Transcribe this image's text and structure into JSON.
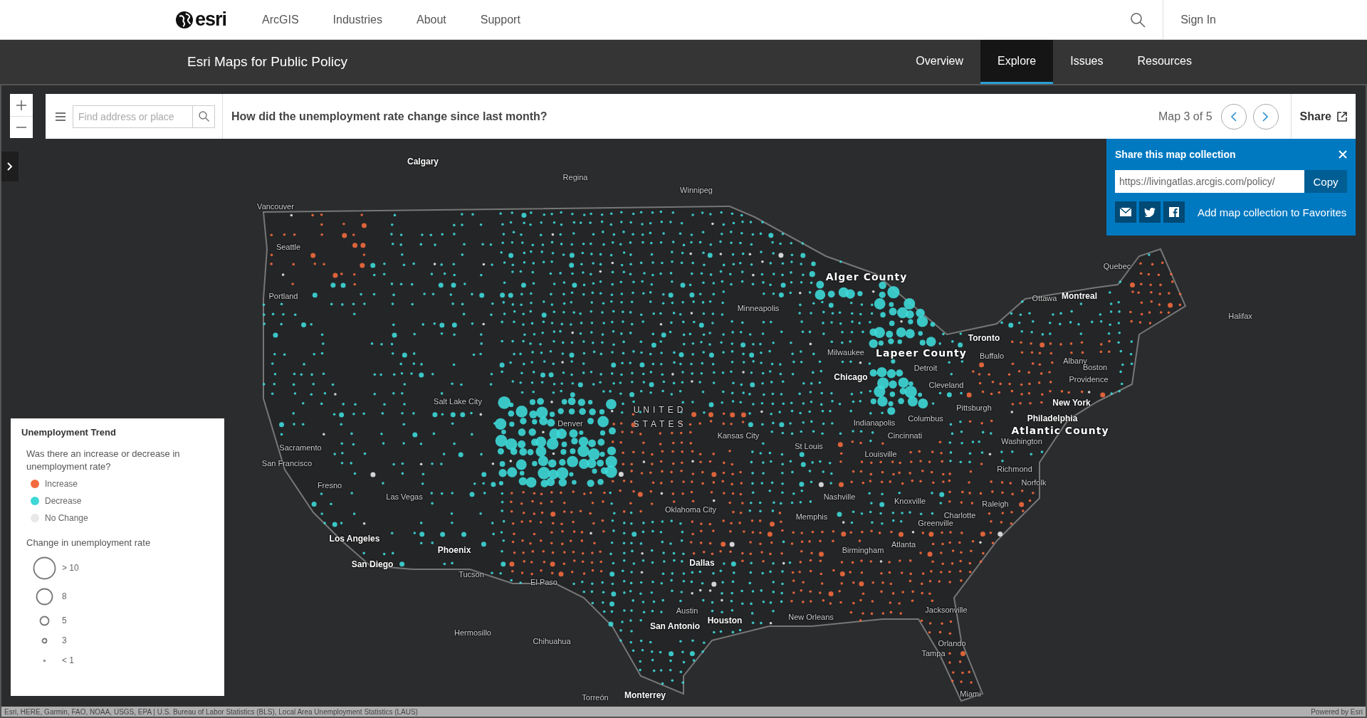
{
  "top_nav": {
    "logo": "esri",
    "links": [
      "ArcGIS",
      "Industries",
      "About",
      "Support"
    ],
    "sign_in": "Sign In"
  },
  "sub_nav": {
    "title": "Esri Maps for Public Policy",
    "tabs": [
      {
        "label": "Overview",
        "selected": false
      },
      {
        "label": "Explore",
        "selected": true
      },
      {
        "label": "Issues",
        "selected": false
      },
      {
        "label": "Resources",
        "selected": false
      }
    ]
  },
  "toolbar": {
    "search": {
      "placeholder": "Find address or place"
    },
    "question": "How did the unemployment rate change since last month?",
    "map_counter": "Map 3 of 5",
    "share": "Share"
  },
  "share_panel": {
    "title": "Share this map collection",
    "url": "https://livingatlas.arcgis.com/policy/",
    "copy": "Copy",
    "favorites": "Add map collection to Favorites"
  },
  "legend": {
    "title": "Unemployment Trend",
    "question": "Was there an increase or decrease in unemployment rate?",
    "trend": [
      {
        "label": "Increase",
        "color": "#f26a3d"
      },
      {
        "label": "Decrease",
        "color": "#3ed8d8"
      },
      {
        "label": "No Change",
        "color": "#e8e8e8"
      }
    ],
    "size_title": "Change in unemployment rate",
    "sizes": [
      "> 10",
      "8",
      "5",
      "3",
      "< 1"
    ]
  },
  "map_labels": [
    {
      "text": "Calgary",
      "kind": "major"
    },
    {
      "text": "Regina",
      "kind": "city"
    },
    {
      "text": "Winnipeg",
      "kind": "city"
    },
    {
      "text": "Vancouver",
      "kind": "city"
    },
    {
      "text": "Seattle",
      "kind": "city"
    },
    {
      "text": "Portland",
      "kind": "city"
    },
    {
      "text": "Quebec",
      "kind": "city"
    },
    {
      "text": "Ottawa",
      "kind": "city"
    },
    {
      "text": "Montreal",
      "kind": "major"
    },
    {
      "text": "Halifax",
      "kind": "city"
    },
    {
      "text": "Minneapolis",
      "kind": "city"
    },
    {
      "text": "Alger County",
      "kind": "highlight"
    },
    {
      "text": "Toronto",
      "kind": "major"
    },
    {
      "text": "Milwaukee",
      "kind": "city"
    },
    {
      "text": "Lapeer County",
      "kind": "highlight"
    },
    {
      "text": "Buffalo",
      "kind": "city"
    },
    {
      "text": "Albany",
      "kind": "city"
    },
    {
      "text": "Detroit",
      "kind": "city"
    },
    {
      "text": "Boston",
      "kind": "city"
    },
    {
      "text": "Chicago",
      "kind": "major"
    },
    {
      "text": "Providence",
      "kind": "city"
    },
    {
      "text": "Cleveland",
      "kind": "city"
    },
    {
      "text": "Salt Lake City",
      "kind": "city"
    },
    {
      "text": "New York",
      "kind": "major"
    },
    {
      "text": "UNITED",
      "kind": "country"
    },
    {
      "text": "Pittsburgh",
      "kind": "city"
    },
    {
      "text": "Denver",
      "kind": "city"
    },
    {
      "text": "STATES",
      "kind": "country"
    },
    {
      "text": "Columbus",
      "kind": "city"
    },
    {
      "text": "Philadelphia",
      "kind": "major"
    },
    {
      "text": "Indianapolis",
      "kind": "city"
    },
    {
      "text": "Atlantic County",
      "kind": "highlight"
    },
    {
      "text": "Kansas City",
      "kind": "city"
    },
    {
      "text": "Cincinnati",
      "kind": "city"
    },
    {
      "text": "Washington",
      "kind": "city"
    },
    {
      "text": "Sacramento",
      "kind": "city"
    },
    {
      "text": "St Louis",
      "kind": "city"
    },
    {
      "text": "Louisville",
      "kind": "city"
    },
    {
      "text": "San Francisco",
      "kind": "city"
    },
    {
      "text": "Richmond",
      "kind": "city"
    },
    {
      "text": "Norfolk",
      "kind": "city"
    },
    {
      "text": "Fresno",
      "kind": "city"
    },
    {
      "text": "Nashville",
      "kind": "city"
    },
    {
      "text": "Knoxville",
      "kind": "city"
    },
    {
      "text": "Las Vegas",
      "kind": "city"
    },
    {
      "text": "Raleigh",
      "kind": "city"
    },
    {
      "text": "Oklahoma City",
      "kind": "city"
    },
    {
      "text": "Memphis",
      "kind": "city"
    },
    {
      "text": "Charlotte",
      "kind": "city"
    },
    {
      "text": "Greenville",
      "kind": "city"
    },
    {
      "text": "Los Angeles",
      "kind": "major"
    },
    {
      "text": "Atlanta",
      "kind": "city"
    },
    {
      "text": "Birmingham",
      "kind": "city"
    },
    {
      "text": "Phoenix",
      "kind": "major"
    },
    {
      "text": "Dallas",
      "kind": "major"
    },
    {
      "text": "San Diego",
      "kind": "major"
    },
    {
      "text": "Tucson",
      "kind": "city"
    },
    {
      "text": "El Paso",
      "kind": "city"
    },
    {
      "text": "Jacksonville",
      "kind": "city"
    },
    {
      "text": "New Orleans",
      "kind": "city"
    },
    {
      "text": "Austin",
      "kind": "city"
    },
    {
      "text": "Houston",
      "kind": "major"
    },
    {
      "text": "San Antonio",
      "kind": "major"
    },
    {
      "text": "Hermosillo",
      "kind": "city"
    },
    {
      "text": "Chihuahua",
      "kind": "city"
    },
    {
      "text": "Orlando",
      "kind": "city"
    },
    {
      "text": "Tampa",
      "kind": "city"
    },
    {
      "text": "Miami",
      "kind": "city"
    },
    {
      "text": "Torreón",
      "kind": "city"
    },
    {
      "text": "Monterrey",
      "kind": "major"
    }
  ],
  "attribution": "Esri, HERE, Garmin, FAO, NOAA, USGS, EPA | U.S. Bureau of Labor Statistics (BLS), Local Area Unemployment Statistics (LAUS)",
  "powered_by": "Powered by Esri"
}
